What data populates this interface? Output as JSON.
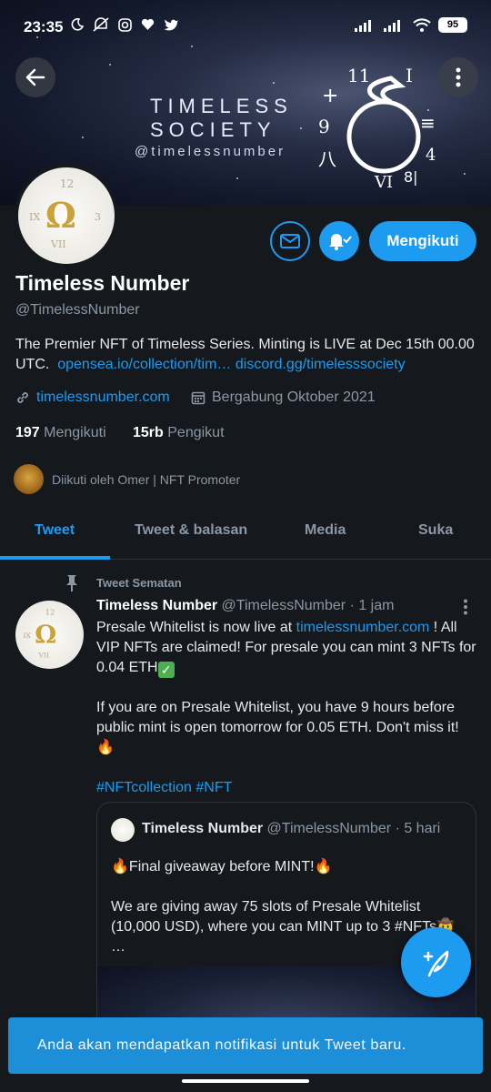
{
  "status_bar": {
    "time": "23:35",
    "battery": "95",
    "icons_left": [
      "moon-icon",
      "mute-icon",
      "instagram-icon",
      "heart-icon",
      "twitter-icon"
    ],
    "icons_right": [
      "signal-icon",
      "signal-icon",
      "wifi-icon",
      "battery-icon"
    ]
  },
  "banner": {
    "title_line1": "TIMELESS",
    "title_line2": "SOCIETY",
    "handle": "@timelessnumber"
  },
  "profile": {
    "name": "Timeless Number",
    "handle": "@TimelessNumber",
    "bio_text": "The Premier NFT of Timeless Series. Minting is LIVE at Dec 15th 00.00 UTC.",
    "bio_link1": "opensea.io/collection/tim…",
    "bio_link2": "discord.gg/timelesssociety",
    "website": "timelessnumber.com",
    "joined": "Bergabung Oktober 2021",
    "following_count": "197",
    "following_label": "Mengikuti",
    "followers_count": "15rb",
    "followers_label": "Pengikut",
    "followed_by": "Diikuti oleh Omer | NFT Promoter",
    "follow_button": "Mengikuti"
  },
  "tabs": [
    "Tweet",
    "Tweet & balasan",
    "Media",
    "Suka"
  ],
  "pinned_tweet": {
    "pinned_label": "Tweet Sematan",
    "author": "Timeless Number",
    "handle": "@TimelessNumber",
    "time": "· 1 jam",
    "line1_pre": "Presale Whitelist is now live at ",
    "line1_link": "timelessnumber.com",
    "line1_post": " !",
    "line2": "All VIP NFTs are claimed! For presale you can mint 3 NFTs for 0.04 ETH",
    "para2": "If you are on Presale Whitelist, you have 9 hours before public mint is open tomorrow for 0.05 ETH. Don't miss it!",
    "hashtags": "#NFTcollection #NFT"
  },
  "quote_tweet": {
    "author": "Timeless Number",
    "handle": "@TimelessNumber",
    "time": "· 5 hari",
    "line1": "Final giveaway before MINT!",
    "para2": "We are giving away 75 slots of Presale Whitelist (10,000 USD), where you can MINT up to 3 #NFTs",
    "ellipsis": "…"
  },
  "toast": "Anda akan mendapatkan notifikasi untuk Tweet baru."
}
